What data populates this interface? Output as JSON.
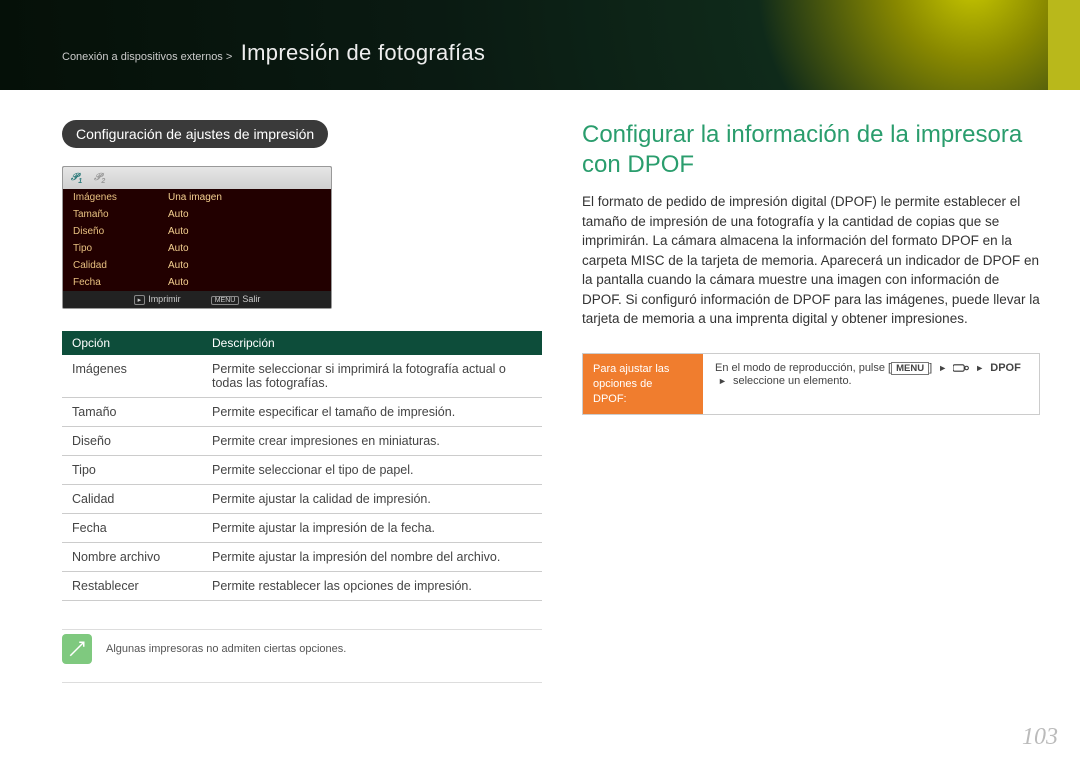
{
  "breadcrumb": {
    "prefix": "Conexión a dispositivos externos >",
    "title": "Impresión de fotografías"
  },
  "left": {
    "section_title": "Configuración de ajustes de impresión",
    "camera": {
      "tab1_icon": "P͟₁",
      "tab2_icon": "P͟₂",
      "rows": [
        {
          "k": "Imágenes",
          "v": "Una imagen"
        },
        {
          "k": "Tamaño",
          "v": "Auto"
        },
        {
          "k": "Diseño",
          "v": "Auto"
        },
        {
          "k": "Tipo",
          "v": "Auto"
        },
        {
          "k": "Calidad",
          "v": "Auto"
        },
        {
          "k": "Fecha",
          "v": "Auto"
        }
      ],
      "footer": {
        "print_icon": "▣",
        "print": "Imprimir",
        "exit_icon": "MENU",
        "exit": "Salir"
      }
    },
    "table": {
      "head_opt": "Opción",
      "head_desc": "Descripción",
      "rows": [
        {
          "opt": "Imágenes",
          "desc": "Permite seleccionar si imprimirá la fotografía actual o todas las fotografías."
        },
        {
          "opt": "Tamaño",
          "desc": "Permite especificar el tamaño de impresión."
        },
        {
          "opt": "Diseño",
          "desc": "Permite crear impresiones en miniaturas."
        },
        {
          "opt": "Tipo",
          "desc": "Permite seleccionar el tipo de papel."
        },
        {
          "opt": "Calidad",
          "desc": "Permite ajustar la calidad de impresión."
        },
        {
          "opt": "Fecha",
          "desc": "Permite ajustar la impresión de la fecha."
        },
        {
          "opt": "Nombre archivo",
          "desc": "Permite ajustar la impresión del nombre del archivo."
        },
        {
          "opt": "Restablecer",
          "desc": "Permite restablecer las opciones de impresión."
        }
      ]
    },
    "note": {
      "icon": "✎",
      "text": "Algunas impresoras no admiten ciertas opciones."
    }
  },
  "right": {
    "title": "Configurar la información de la impresora con DPOF",
    "body": "El formato de pedido de impresión digital (DPOF) le permite establecer el tamaño de impresión de una fotografía y la cantidad de copias que se imprimirán. La cámara almacena la información del formato DPOF en la carpeta MISC de la tarjeta de memoria. Aparecerá un indicador de DPOF en la pantalla cuando la cámara muestre una imagen con información de DPOF. Si configuró información de DPOF para las imágenes, puede llevar la tarjeta de memoria a una imprenta digital y obtener impresiones.",
    "dpof": {
      "left1": "Para ajustar las",
      "left2": "opciones de",
      "left3": "DPOF:",
      "r_pre": "En el modo de reproducción, pulse [",
      "r_menu": "MENU",
      "r_post1": "] ",
      "arrow": "►",
      "r_dpof": "DPOF",
      "r_line2_pre": "► ",
      "r_line2": "seleccione un elemento."
    }
  },
  "page_number": "103"
}
